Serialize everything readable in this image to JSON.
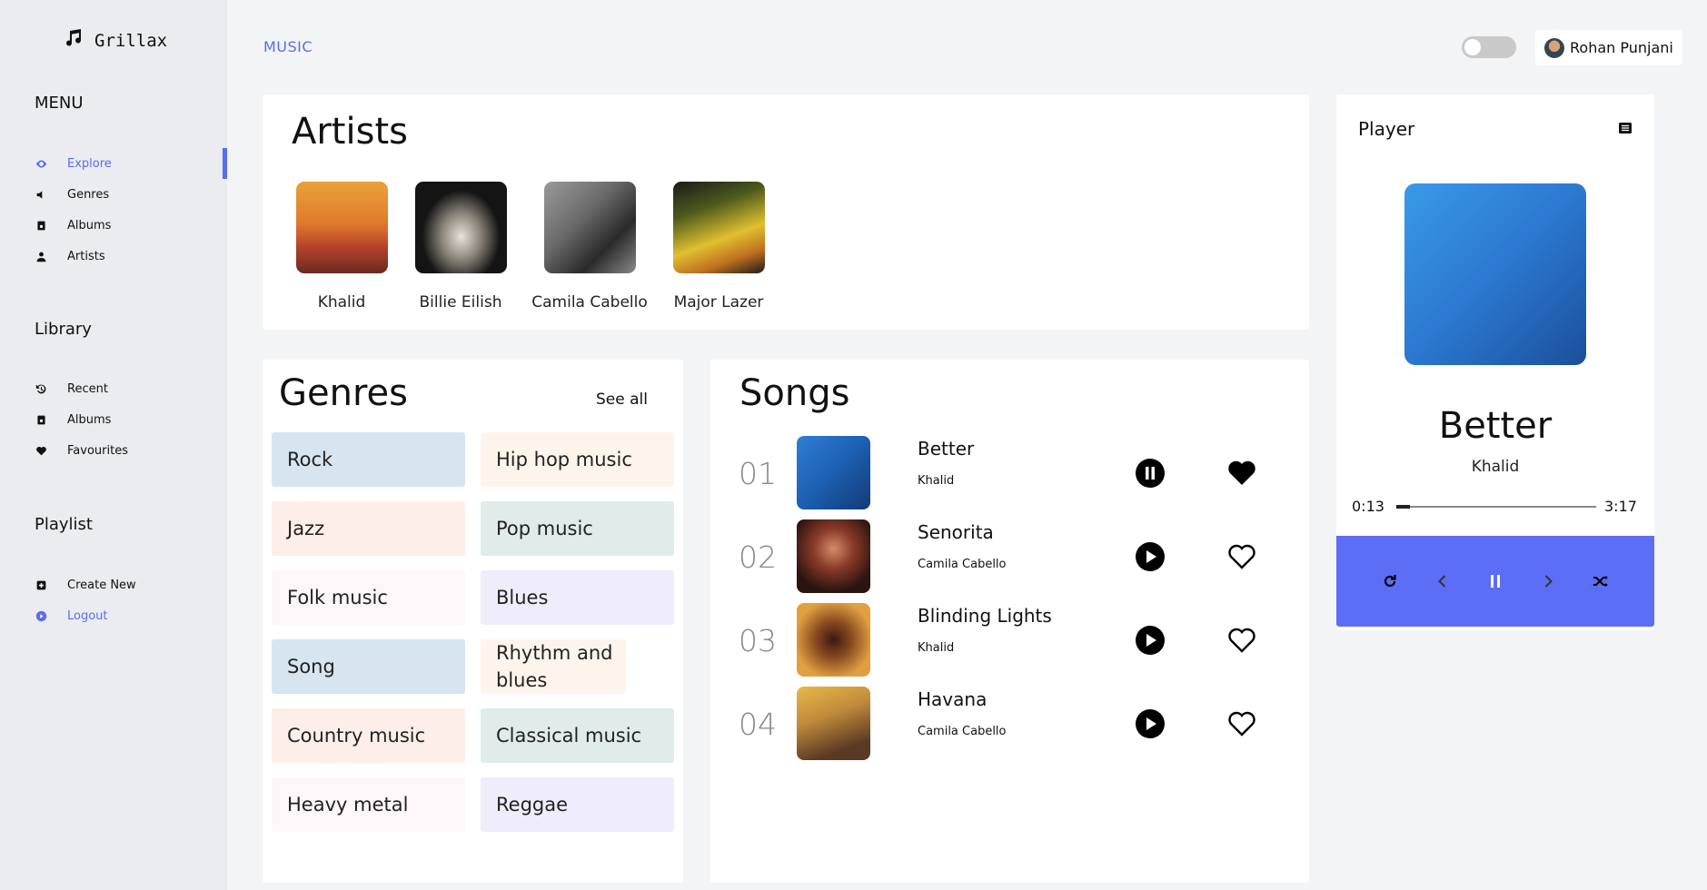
{
  "brand": {
    "name": "Grillax",
    "icon": "music-note-icon"
  },
  "sidebar": {
    "menu_title": "MENU",
    "menu_items": [
      {
        "label": "Explore",
        "icon": "eye-icon",
        "active": true
      },
      {
        "label": "Genres",
        "icon": "speaker-icon"
      },
      {
        "label": "Albums",
        "icon": "album-icon"
      },
      {
        "label": "Artists",
        "icon": "user-icon"
      }
    ],
    "library_title": "Library",
    "library_items": [
      {
        "label": "Recent",
        "icon": "history-icon"
      },
      {
        "label": "Albums",
        "icon": "album-icon"
      },
      {
        "label": "Favourites",
        "icon": "heart-icon"
      }
    ],
    "playlist_title": "Playlist",
    "playlist_items": [
      {
        "label": "Create New",
        "icon": "plus-box-icon"
      },
      {
        "label": "Logout",
        "icon": "play-circle-icon",
        "active": true
      }
    ]
  },
  "header": {
    "breadcrumb": "MUSIC",
    "user_name": "Rohan Punjani"
  },
  "artists": {
    "title": "Artists",
    "items": [
      {
        "name": "Khalid"
      },
      {
        "name": "Billie Eilish"
      },
      {
        "name": "Camila Cabello"
      },
      {
        "name": "Major Lazer"
      }
    ]
  },
  "genres": {
    "title": "Genres",
    "see_all": "See all",
    "items": [
      {
        "label": "Rock",
        "color": "#d6e5f0"
      },
      {
        "label": "Hip hop music",
        "color": "#fdf5ec"
      },
      {
        "label": "Jazz",
        "color": "#fdeee9"
      },
      {
        "label": "Pop music",
        "color": "#e1ebea"
      },
      {
        "label": "Folk music",
        "color": "#fdf7f9"
      },
      {
        "label": "Blues",
        "color": "#efedfb"
      },
      {
        "label": "Song",
        "color": "#d6e5f0"
      },
      {
        "label": "Rhythm and blues",
        "color": "#fdf5ec"
      },
      {
        "label": "Country music",
        "color": "#fdeee9"
      },
      {
        "label": "Classical music",
        "color": "#e1ebea"
      },
      {
        "label": "Heavy metal",
        "color": "#fdf7f9"
      },
      {
        "label": "Reggae",
        "color": "#efedfb"
      }
    ]
  },
  "songs": {
    "title": "Songs",
    "items": [
      {
        "num": "01",
        "title": "Better",
        "artist": "Khalid",
        "playing": true,
        "liked": true
      },
      {
        "num": "02",
        "title": "Senorita",
        "artist": "Camila Cabello",
        "playing": false,
        "liked": false
      },
      {
        "num": "03",
        "title": "Blinding Lights",
        "artist": "Khalid",
        "playing": false,
        "liked": false
      },
      {
        "num": "04",
        "title": "Havana",
        "artist": "Camila Cabello",
        "playing": false,
        "liked": false
      }
    ]
  },
  "player": {
    "title": "Player",
    "track": "Better",
    "artist": "Khalid",
    "elapsed": "0:13",
    "duration": "3:17",
    "progress": 0.07,
    "accent": "#5b6ef5"
  }
}
